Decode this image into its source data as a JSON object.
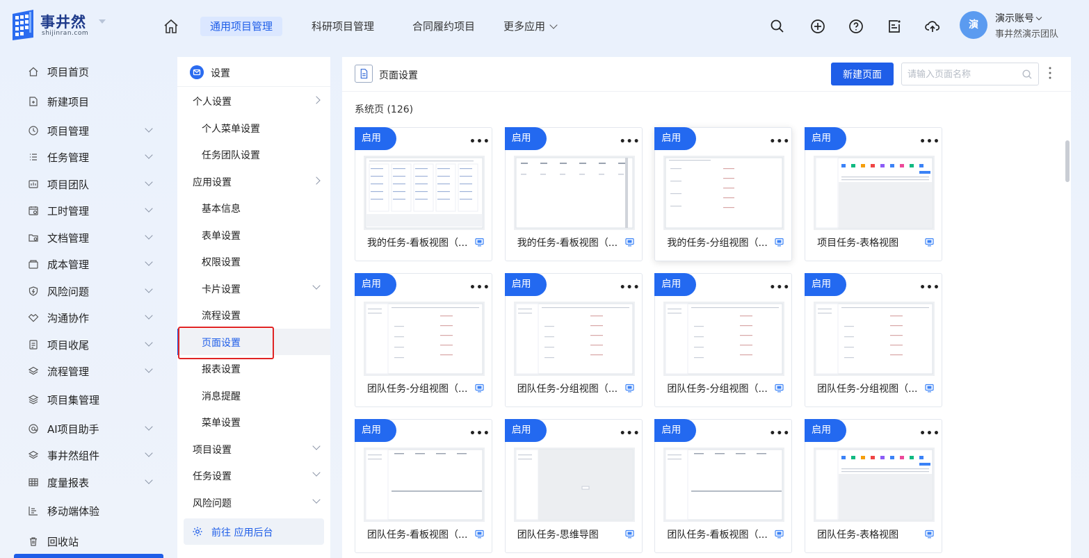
{
  "brand": {
    "name": "事井然",
    "domain": "shijinran.com",
    "primary_color": "#1f5ee8"
  },
  "topnav": {
    "tabs": [
      {
        "label": "通用项目管理",
        "active": true
      },
      {
        "label": "科研项目管理",
        "active": false
      },
      {
        "label": "合同履约项目",
        "active": false
      },
      {
        "label": "更多应用",
        "active": false
      }
    ],
    "icons": [
      "search-icon",
      "add-circle-icon",
      "help-icon",
      "notes-icon",
      "cloud-upload-icon"
    ]
  },
  "user": {
    "avatar_text": "演",
    "name": "演示账号",
    "team": "事井然演示团队"
  },
  "sidebar": {
    "items": [
      {
        "label": "项目首页",
        "icon": "home-icon",
        "expandable": false
      },
      {
        "label": "新建项目",
        "icon": "new-doc-icon",
        "expandable": false
      },
      {
        "label": "项目管理",
        "icon": "clock-icon",
        "expandable": true
      },
      {
        "label": "任务管理",
        "icon": "list-icon",
        "expandable": true
      },
      {
        "label": "项目团队",
        "icon": "team-icon",
        "expandable": true
      },
      {
        "label": "工时管理",
        "icon": "calendar-icon",
        "expandable": true
      },
      {
        "label": "文档管理",
        "icon": "folder-icon",
        "expandable": true
      },
      {
        "label": "成本管理",
        "icon": "wallet-icon",
        "expandable": true
      },
      {
        "label": "风险问题",
        "icon": "shield-icon",
        "expandable": true
      },
      {
        "label": "沟通协作",
        "icon": "handshake-icon",
        "expandable": true
      },
      {
        "label": "项目收尾",
        "icon": "checklist-icon",
        "expandable": true
      },
      {
        "label": "流程管理",
        "icon": "layers-icon",
        "expandable": true
      },
      {
        "label": "项目集管理",
        "icon": "stack-icon",
        "expandable": false
      },
      {
        "label": "AI项目助手",
        "icon": "at-icon",
        "expandable": true
      },
      {
        "label": "事井然组件",
        "icon": "layers-icon",
        "expandable": true
      },
      {
        "label": "度量报表",
        "icon": "table-icon",
        "expandable": true
      },
      {
        "label": "移动端体验",
        "icon": "bar-chart-icon",
        "expandable": false
      },
      {
        "label": "回收站",
        "icon": "trash-icon",
        "expandable": false
      }
    ]
  },
  "settings": {
    "title": "设置",
    "items": [
      {
        "label": "个人设置",
        "kind": "group",
        "chevron": "right"
      },
      {
        "label": "个人菜单设置",
        "kind": "child"
      },
      {
        "label": "任务团队设置",
        "kind": "child"
      },
      {
        "label": "应用设置",
        "kind": "group",
        "chevron": "right"
      },
      {
        "label": "基本信息",
        "kind": "child"
      },
      {
        "label": "表单设置",
        "kind": "child"
      },
      {
        "label": "权限设置",
        "kind": "child"
      },
      {
        "label": "卡片设置",
        "kind": "child",
        "chevron": "down"
      },
      {
        "label": "流程设置",
        "kind": "child"
      },
      {
        "label": "页面设置",
        "kind": "child",
        "active": true
      },
      {
        "label": "报表设置",
        "kind": "child"
      },
      {
        "label": "消息提醒",
        "kind": "child"
      },
      {
        "label": "菜单设置",
        "kind": "child"
      },
      {
        "label": "项目设置",
        "kind": "group",
        "chevron": "down"
      },
      {
        "label": "任务设置",
        "kind": "group",
        "chevron": "down"
      },
      {
        "label": "风险问题",
        "kind": "group",
        "chevron": "down"
      }
    ],
    "goto_admin": "前往 应用后台"
  },
  "main": {
    "title": "页面设置",
    "new_button": "新建页面",
    "search_placeholder": "请输入页面名称",
    "section_title": "系统页 (126)",
    "cards": [
      {
        "badge": "启用",
        "title": "我的任务-看板视图（...",
        "thumb": "kanban"
      },
      {
        "badge": "启用",
        "title": "我的任务-看板视图（...",
        "thumb": "columns"
      },
      {
        "badge": "启用",
        "title": "我的任务-分组视图（...",
        "thumb": "group"
      },
      {
        "badge": "启用",
        "title": "项目任务-表格视图",
        "thumb": "table"
      },
      {
        "badge": "启用",
        "title": "团队任务-分组视图（...",
        "thumb": "group-side"
      },
      {
        "badge": "启用",
        "title": "团队任务-分组视图（...",
        "thumb": "group-side"
      },
      {
        "badge": "启用",
        "title": "团队任务-分组视图（...",
        "thumb": "group-side"
      },
      {
        "badge": "启用",
        "title": "团队任务-分组视图（...",
        "thumb": "group-side"
      },
      {
        "badge": "启用",
        "title": "团队任务-看板视图（...",
        "thumb": "kanban-side"
      },
      {
        "badge": "启用",
        "title": "团队任务-思维导图",
        "thumb": "mindmap"
      },
      {
        "badge": "启用",
        "title": "团队任务-看板视图（...",
        "thumb": "kanban-side"
      },
      {
        "badge": "启用",
        "title": "团队任务-表格视图",
        "thumb": "table"
      }
    ]
  }
}
